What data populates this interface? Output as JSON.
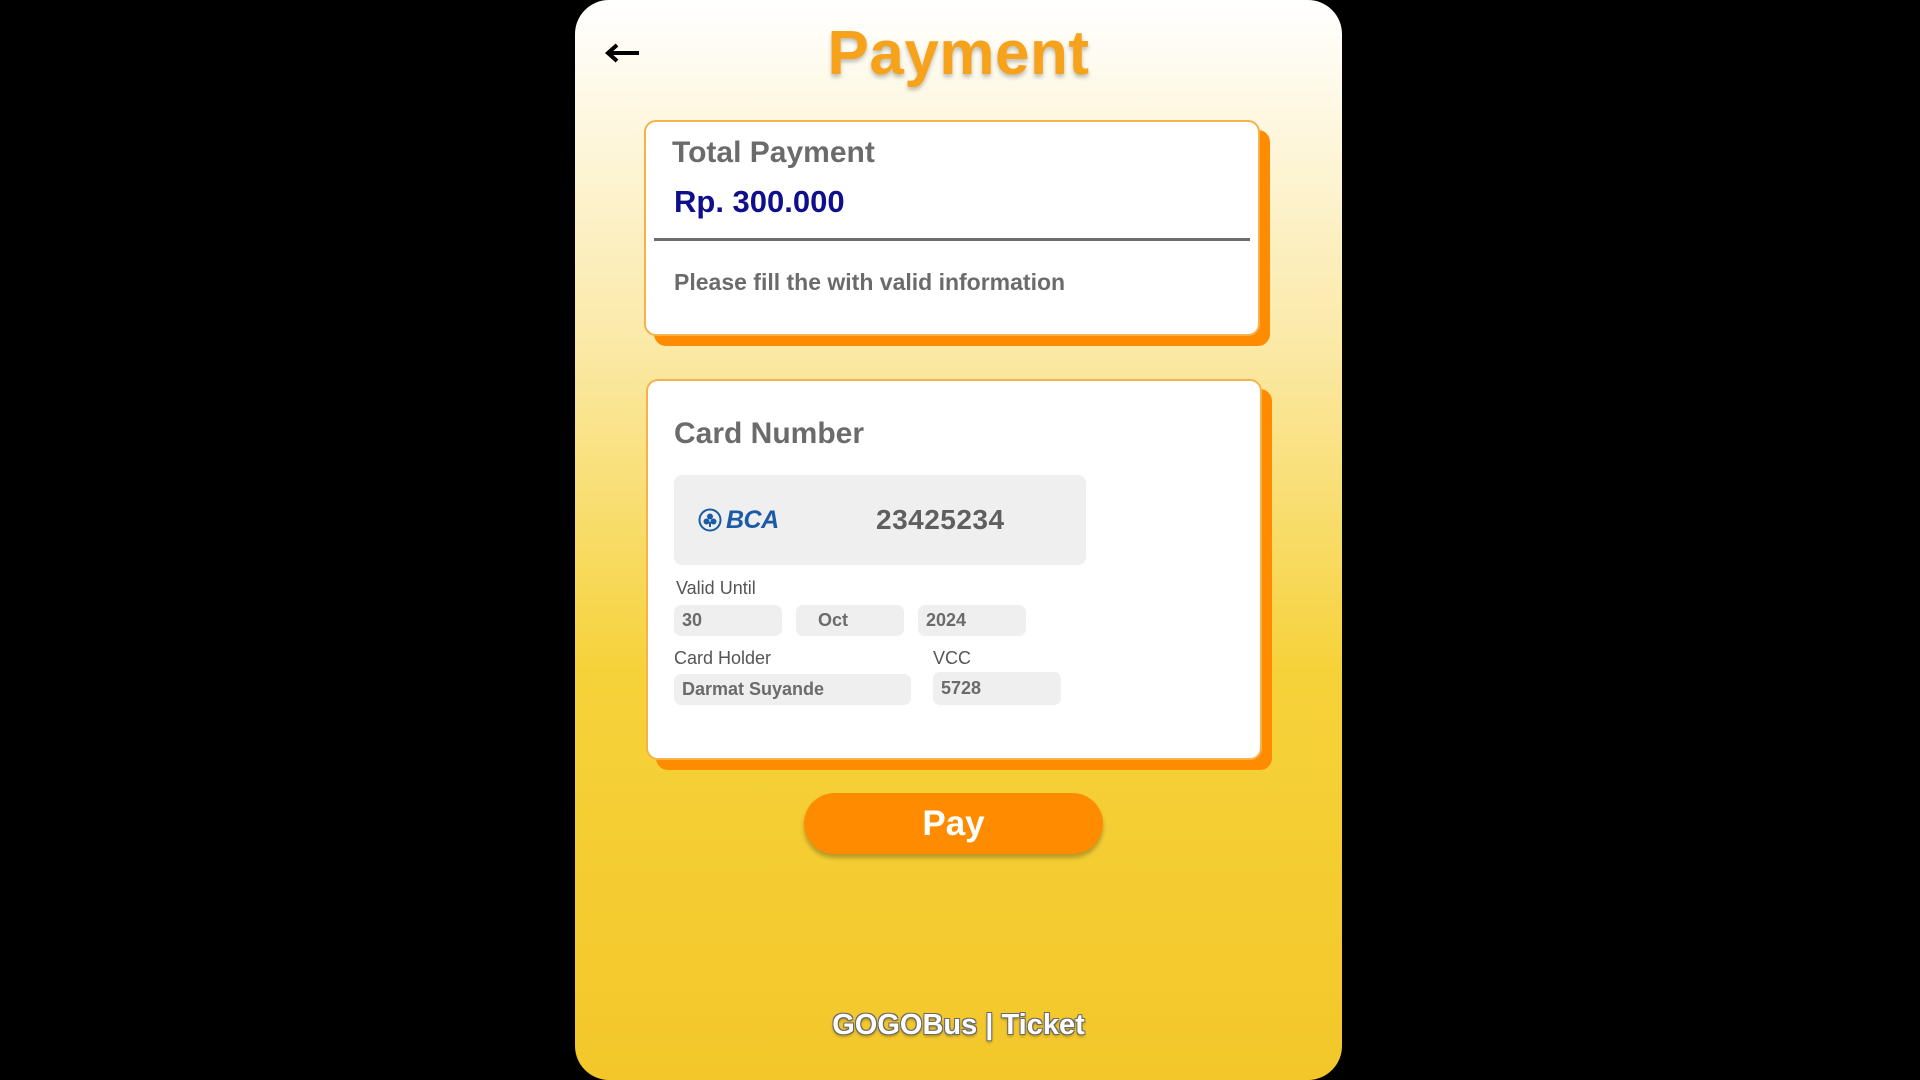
{
  "header": {
    "title": "Payment",
    "back_icon": "arrow-left-icon"
  },
  "total": {
    "label": "Total Payment",
    "amount": "Rp. 300.000",
    "note": "Please fill the with valid information"
  },
  "card": {
    "section_label": "Card Number",
    "bank_logo_text": "BCA",
    "number": "23425234",
    "valid_until_label": "Valid Until",
    "valid_day": "30",
    "valid_month": "Oct",
    "valid_year": "2024",
    "holder_label": "Card Holder",
    "holder_value": "Darmat Suyande",
    "vcc_label": "VCC",
    "vcc_value": "5728"
  },
  "actions": {
    "pay_label": "Pay"
  },
  "footer": {
    "brand": "GOGOBus | Ticket"
  },
  "colors": {
    "accent": "#ff8c00",
    "title": "#f6a21a",
    "amount": "#0f0f8e",
    "bank": "#1b5aa6"
  }
}
